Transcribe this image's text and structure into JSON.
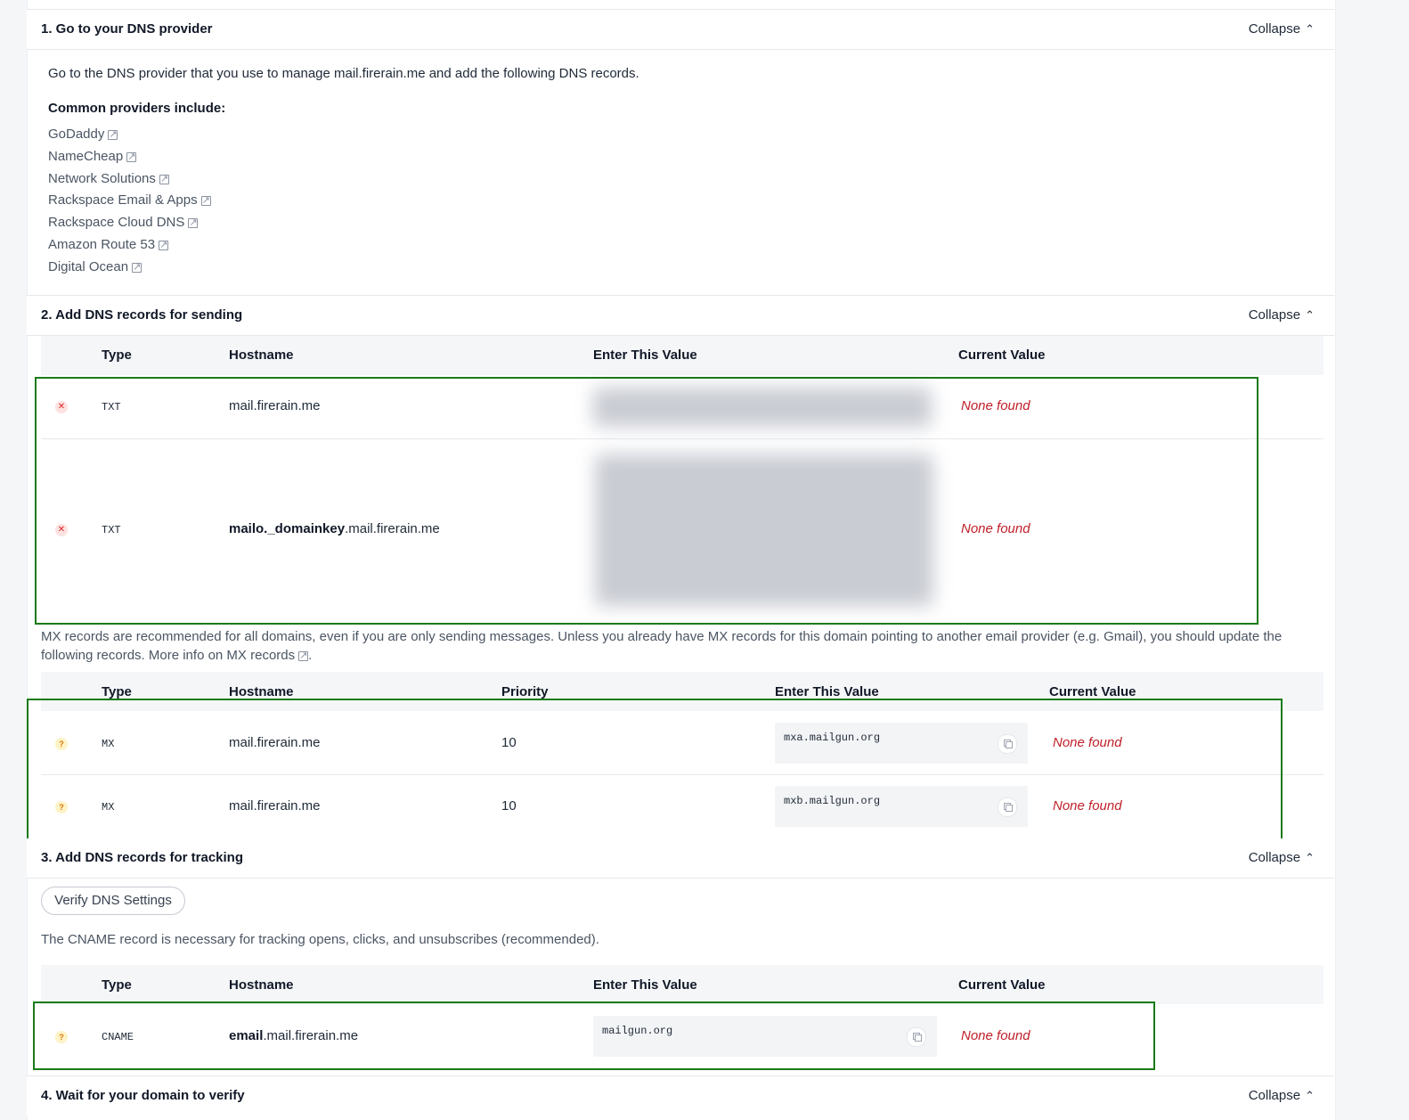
{
  "sections": {
    "s1": {
      "title": "1. Go to your DNS provider",
      "collapse": "Collapse"
    },
    "s2": {
      "title": "2. Add DNS records for sending",
      "collapse": "Collapse"
    },
    "s3": {
      "title": "3. Add DNS records for tracking",
      "collapse": "Collapse"
    },
    "s4": {
      "title": "4. Wait for your domain to verify",
      "collapse": "Collapse"
    }
  },
  "intro": "Go to the DNS provider that you use to manage mail.firerain.me and add the following DNS records.",
  "providers_heading": "Common providers include:",
  "providers": [
    "GoDaddy",
    "NameCheap",
    "Network Solutions",
    "Rackspace Email & Apps",
    "Rackspace Cloud DNS",
    "Amazon Route 53",
    "Digital Ocean"
  ],
  "sending_table": {
    "headers": [
      "Type",
      "Hostname",
      "Enter This Value",
      "Current Value"
    ],
    "rows": [
      {
        "type": "TXT",
        "host_bold": "",
        "host": "mail.firerain.me",
        "current": "None found"
      },
      {
        "type": "TXT",
        "host_bold": "mailo._domainkey",
        "host": ".mail.firerain.me",
        "current": "None found"
      }
    ]
  },
  "mx_note_line1": "MX records are recommended for all domains, even if you are only sending messages. Unless you already have MX records for this domain pointing to another email provider (e.g. Gmail), you should update the",
  "mx_note_line2": "following records. More info on MX records",
  "mx_note_end": ".",
  "mx_table": {
    "headers": [
      "Type",
      "Hostname",
      "Priority",
      "Enter This Value",
      "Current Value"
    ],
    "rows": [
      {
        "type": "MX",
        "host": "mail.firerain.me",
        "priority": "10",
        "value": "mxa.mailgun.org",
        "current": "None found"
      },
      {
        "type": "MX",
        "host": "mail.firerain.me",
        "priority": "10",
        "value": "mxb.mailgun.org",
        "current": "None found"
      }
    ]
  },
  "verify_button": "Verify DNS Settings",
  "cname_note": "The CNAME record is necessary for tracking opens, clicks, and unsubscribes (recommended).",
  "tracking_table": {
    "headers": [
      "Type",
      "Hostname",
      "Enter This Value",
      "Current Value"
    ],
    "rows": [
      {
        "type": "CNAME",
        "host_bold": "email",
        "host": ".mail.firerain.me",
        "value": "mailgun.org",
        "current": "None found"
      }
    ]
  },
  "icons": {
    "error": "x-icon",
    "warning": "question-icon",
    "external": "external-link-icon",
    "copy": "copy-icon",
    "collapse": "chevron-up-icon"
  },
  "colors": {
    "error": "#c0202a",
    "highlight": "#1a7a1a"
  }
}
